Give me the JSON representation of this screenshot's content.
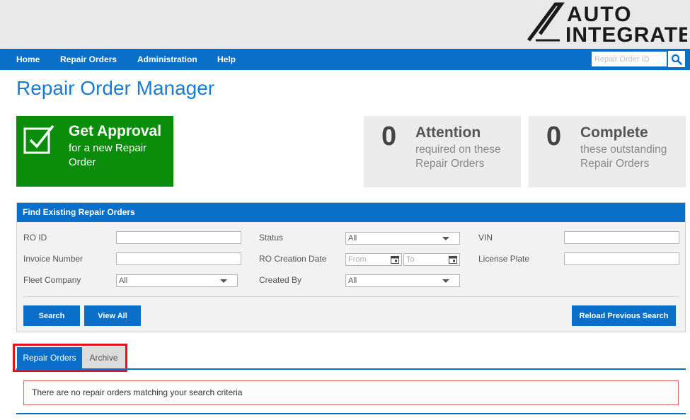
{
  "brand": {
    "line1": "AUTO",
    "line2": "INTEGRATE"
  },
  "nav": {
    "items": [
      {
        "label": "Home"
      },
      {
        "label": "Repair Orders"
      },
      {
        "label": "Administration"
      },
      {
        "label": "Help"
      }
    ],
    "search_placeholder": "Repair Order ID"
  },
  "page_title": "Repair Order Manager",
  "approval_card": {
    "title": "Get Approval",
    "subtitle": "for a new Repair Order"
  },
  "attention_card": {
    "count": "0",
    "title": "Attention",
    "subtitle": "required on these Repair Orders"
  },
  "complete_card": {
    "count": "0",
    "title": "Complete",
    "subtitle": "these outstanding Repair Orders"
  },
  "find": {
    "header": "Find Existing Repair Orders",
    "ro_id_label": "RO ID",
    "invoice_label": "Invoice Number",
    "fleet_label": "Fleet Company",
    "fleet_value": "All",
    "status_label": "Status",
    "status_value": "All",
    "creation_label": "RO Creation Date",
    "from_placeholder": "From",
    "to_placeholder": "To",
    "created_by_label": "Created By",
    "created_by_value": "All",
    "vin_label": "VIN",
    "plate_label": "License Plate",
    "search_button": "Search",
    "view_all_button": "View All",
    "reload_button": "Reload Previous Search"
  },
  "tabs": {
    "active": "Repair Orders",
    "inactive": "Archive"
  },
  "message": "There are no repair orders matching your search criteria",
  "colors": {
    "primary": "#0a6fc8",
    "approval_green": "#0a8d0a",
    "highlight_red": "#e0141e"
  }
}
